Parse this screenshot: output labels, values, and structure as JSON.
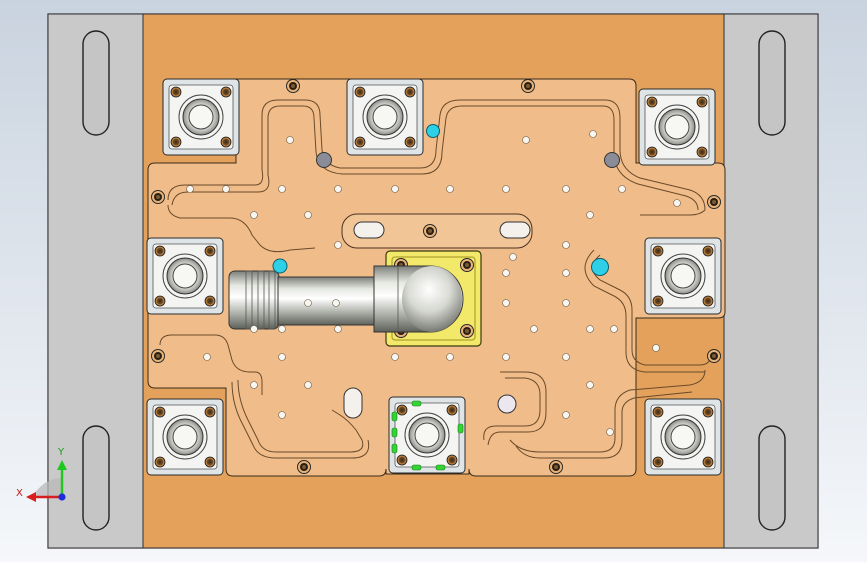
{
  "viewport": {
    "background_top": "#c9d3df",
    "background_bottom": "#f5f7fa"
  },
  "model": {
    "rails_color": "#c9c9c9",
    "base_plate_color": "#e3a15c",
    "insert_plate_color": "#f0bd8a",
    "holder_color": "#f2e86a",
    "pocket_color": "#dfe4e6",
    "cyan_hole_color": "#2ed0e8",
    "green_marker_color": "#35d435",
    "nozzle_part": "cylinder-nozzle"
  },
  "triad": {
    "x_label": "X",
    "y_label": "Y",
    "x_color": "#d81e1e",
    "y_color": "#1ec81e",
    "z_color": "#1e2ed8"
  }
}
